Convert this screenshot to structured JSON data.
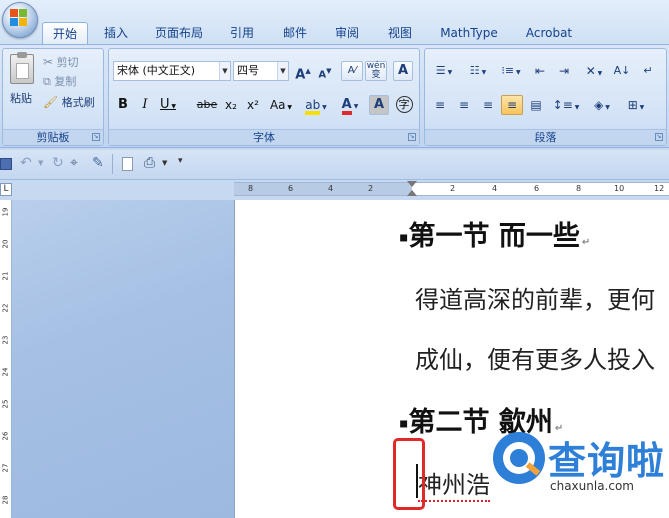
{
  "tabs": [
    "开始",
    "插入",
    "页面布局",
    "引用",
    "邮件",
    "审阅",
    "视图",
    "MathType",
    "Acrobat"
  ],
  "clipboard": {
    "paste": "粘贴",
    "cut": "剪切",
    "copy": "复制",
    "format_painter": "格式刷",
    "group_label": "剪贴板"
  },
  "font": {
    "name": "宋体 (中文正文)",
    "size": "四号",
    "group_label": "字体",
    "grow": "A",
    "shrink": "A",
    "bold": "B",
    "italic": "I",
    "underline": "U",
    "strike": "abe",
    "sub": "x₂",
    "sup": "x²",
    "case": "Aa",
    "color_a": "A",
    "char_shade": "A",
    "phonetic": "wén",
    "phonetic2": "变",
    "enclose": "字"
  },
  "paragraph": {
    "group_label": "段落"
  },
  "hruler_ticks": [
    "8",
    "6",
    "4",
    "2",
    "2",
    "4",
    "6",
    "8",
    "10",
    "12"
  ],
  "vruler_ticks": [
    "19",
    "20",
    "21",
    "22",
    "23",
    "24",
    "25",
    "26",
    "27",
    "28"
  ],
  "document": {
    "heading1": "第一节 而一些",
    "line1": "得道高深的前辈，更何",
    "line2": "成仙，便有更多人投入",
    "heading2": "第二节 歙州",
    "line3": "神州浩"
  },
  "watermark": {
    "name": "查询啦",
    "url": "chaxunla.com"
  },
  "colors": {
    "highlight_red": "#e02a2a",
    "watermark_blue": "#2d7fd8",
    "font_color_red": "#e02a2a",
    "highlight_yellow": "#f5e000"
  }
}
